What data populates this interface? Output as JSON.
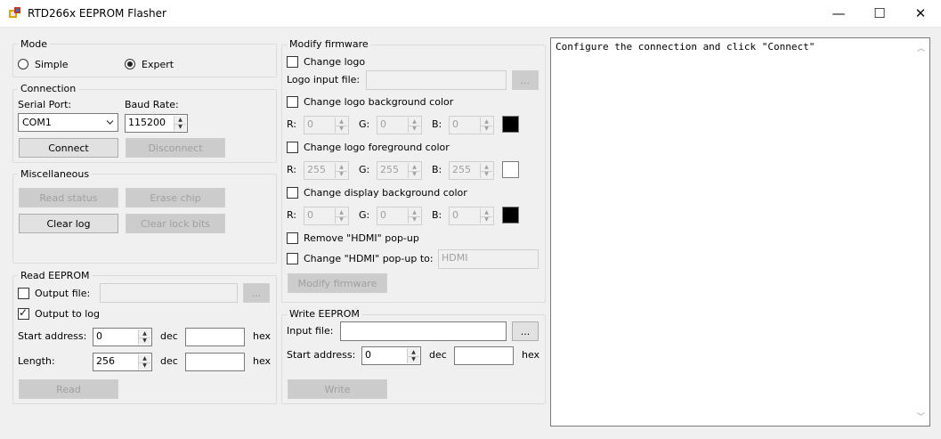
{
  "window": {
    "title": "RTD266x EEPROM Flasher",
    "minimize": "—",
    "maximize": "☐",
    "close": "✕"
  },
  "mode": {
    "legend": "Mode",
    "simple": "Simple",
    "expert": "Expert",
    "selected": "Expert"
  },
  "connection": {
    "legend": "Connection",
    "serial_port_label": "Serial Port:",
    "serial_port_value": "COM1",
    "baud_rate_label": "Baud Rate:",
    "baud_rate_value": "115200",
    "connect": "Connect",
    "disconnect": "Disconnect"
  },
  "misc": {
    "legend": "Miscellaneous",
    "read_status": "Read status",
    "erase_chip": "Erase chip",
    "clear_log": "Clear log",
    "clear_lock_bits": "Clear lock bits"
  },
  "read_eeprom": {
    "legend": "Read EEPROM",
    "output_file_label": "Output file:",
    "output_file_checked": false,
    "browse": "...",
    "output_to_log_label": "Output to log",
    "output_to_log_checked": true,
    "start_address_label": "Start address:",
    "start_address_dec": "0",
    "dec": "dec",
    "hex": "hex",
    "length_label": "Length:",
    "length_dec": "256",
    "read": "Read"
  },
  "modify_firmware": {
    "legend": "Modify firmware",
    "change_logo": "Change logo",
    "logo_input_label": "Logo input file:",
    "browse": "...",
    "change_logo_bg": "Change logo background color",
    "logo_bg": {
      "r": "0",
      "g": "0",
      "b": "0",
      "color": "#000000"
    },
    "change_logo_fg": "Change logo foreground color",
    "logo_fg": {
      "r": "255",
      "g": "255",
      "b": "255",
      "color": "#ffffff"
    },
    "change_display_bg": "Change display background color",
    "display_bg": {
      "r": "0",
      "g": "0",
      "b": "0",
      "color": "#000000"
    },
    "r_label": "R:",
    "g_label": "G:",
    "b_label": "B:",
    "remove_hdmi": "Remove \"HDMI\" pop-up",
    "change_hdmi": "Change \"HDMI\" pop-up to:",
    "hdmi_value": "HDMI",
    "modify_button": "Modify firmware"
  },
  "write_eeprom": {
    "legend": "Write EEPROM",
    "input_file_label": "Input file:",
    "browse": "...",
    "start_address_label": "Start address:",
    "start_address_dec": "0",
    "dec": "dec",
    "hex": "hex",
    "write": "Write"
  },
  "log": {
    "text": "Configure the connection and click \"Connect\""
  },
  "icons": {
    "app": "app-icon",
    "spin_up": "▲",
    "spin_down": "▼",
    "combo_arrow": "chevron-down-icon",
    "scroll_up": "︿",
    "scroll_down": "﹀"
  }
}
